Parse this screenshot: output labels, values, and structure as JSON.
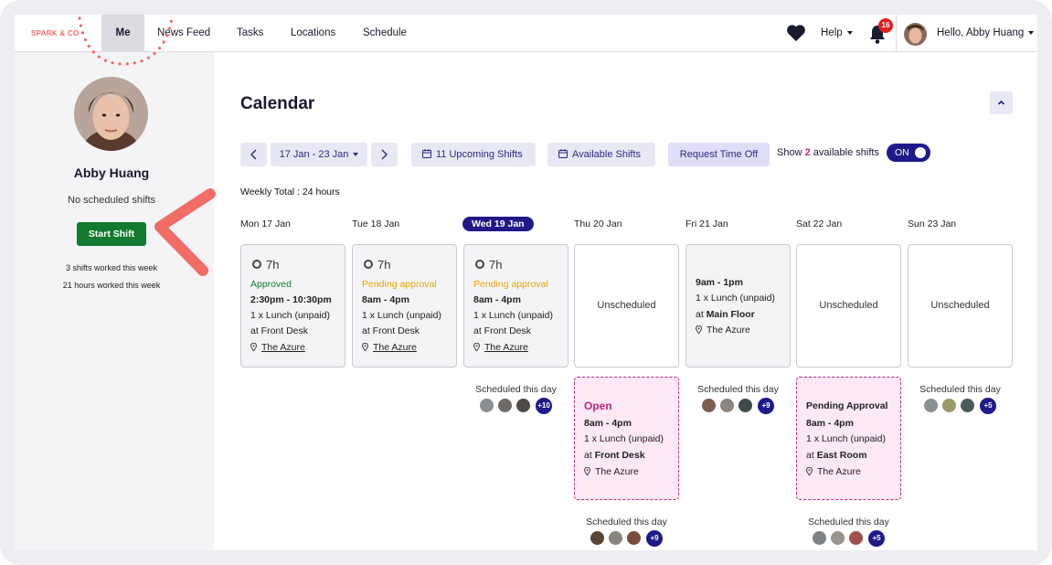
{
  "nav": {
    "logo": "SPARK & CO",
    "items": [
      "Me",
      "News Feed",
      "Tasks",
      "Locations",
      "Schedule"
    ],
    "help": "Help",
    "notifications": "16",
    "greeting": "Hello, Abby Huang"
  },
  "sidebar": {
    "name": "Abby Huang",
    "status": "No scheduled shifts",
    "start_shift": "Start Shift",
    "shifts_worked": "3 shifts worked this week",
    "hours_worked": "21 hours worked this week"
  },
  "calendar": {
    "title": "Calendar",
    "date_range": "17 Jan - 23 Jan",
    "upcoming_shifts": "11 Upcoming Shifts",
    "available_shifts": "Available Shifts",
    "request_time_off": "Request Time Off",
    "show_prefix": "Show",
    "show_count": "2",
    "show_suffix": "available shifts",
    "toggle": "ON",
    "weekly_total": "Weekly Total : 24 hours",
    "days": [
      "Mon 17 Jan",
      "Tue 18 Jan",
      "Wed 19 Jan",
      "Thu 20 Jan",
      "Fri 21 Jan",
      "Sat 22 Jan",
      "Sun 23 Jan"
    ],
    "today_index": 2,
    "shifts": [
      {
        "hours": "7h",
        "status": "Approved",
        "time": "2:30pm - 10:30pm",
        "break": "1 x Lunch (unpaid)",
        "at": "at Front Desk",
        "location": "The Azure"
      },
      {
        "hours": "7h",
        "status": "Pending approval",
        "time": "8am - 4pm",
        "break": "1 x Lunch (unpaid)",
        "at": "at Front Desk",
        "location": "The Azure"
      },
      {
        "hours": "7h",
        "status": "Pending approval",
        "time": "8am - 4pm",
        "break": "1 x Lunch (unpaid)",
        "at": "at Front Desk",
        "location": "The Azure"
      }
    ],
    "unscheduled": "Unscheduled",
    "fri_shift": {
      "time": "9am - 1pm",
      "break": "1 x Lunch (unpaid)",
      "at_prefix": "at",
      "at_place": "Main Floor",
      "location": "The Azure"
    },
    "open_shift": {
      "title": "Open",
      "time": "8am - 4pm",
      "break": "1 x Lunch (unpaid)",
      "at_prefix": "at",
      "at_place": "Front Desk",
      "location": "The Azure"
    },
    "pending_shift": {
      "title": "Pending Approval",
      "time": "8am - 4pm",
      "break": "1 x Lunch (unpaid)",
      "at_prefix": "at",
      "at_place": "East Room",
      "location": "The Azure"
    },
    "scheduled_label": "Scheduled this day",
    "more_counts": {
      "wed": "+10",
      "fri": "+9",
      "sun": "+5",
      "thu": "+9",
      "sat": "+5"
    }
  },
  "colors": {
    "accent": "#1f1a8a",
    "approved": "#127b2f",
    "pending": "#e6a400",
    "open": "#c0267f",
    "start_shift": "#127b2f"
  }
}
